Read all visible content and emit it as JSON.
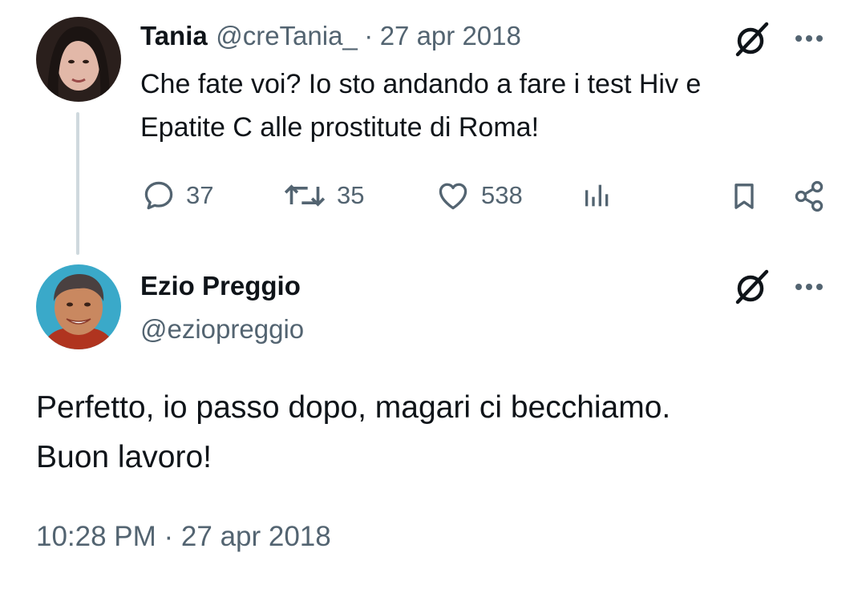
{
  "reply_to": {
    "author_name": "Tania",
    "handle": "@creTania_",
    "separator": "·",
    "date": "27 apr 2018",
    "text_line1": "Che fate voi? Io sto andando a fare i test Hiv e",
    "text_line2": "Epatite C alle prostitute di Roma!",
    "stats": {
      "replies": "37",
      "reposts": "35",
      "likes": "538"
    },
    "icons": [
      "grok-icon",
      "more-icon",
      "reply-icon",
      "repost-icon",
      "like-icon",
      "views-icon",
      "bookmark-icon",
      "share-icon"
    ]
  },
  "main_tweet": {
    "author_name": "Ezio Preggio",
    "handle": "@eziopreggio",
    "text_line1": "Perfetto, io passo dopo, magari ci becchiamo.",
    "text_line2": "Buon lavoro!",
    "timestamp": "10:28 PM · 27 apr 2018"
  },
  "colors": {
    "text": "#0f1419",
    "muted": "#536471",
    "thread_line": "#cfd9de"
  }
}
